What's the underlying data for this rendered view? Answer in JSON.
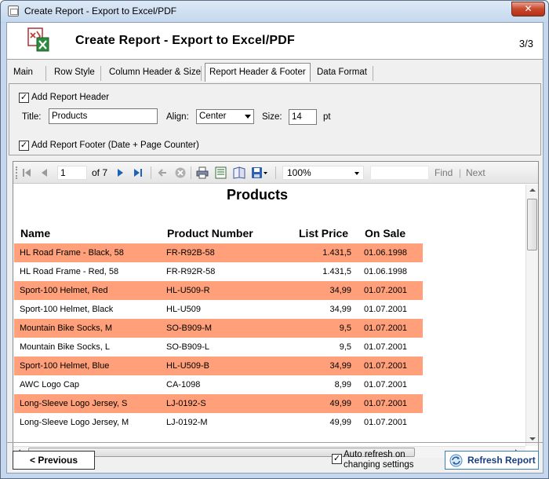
{
  "window": {
    "title": "Create Report - Export to Excel/PDF",
    "close_label": "✕"
  },
  "header": {
    "title": "Create Report - Export to Excel/PDF",
    "step": "3/3"
  },
  "tabs": [
    {
      "label": "Main",
      "active": false
    },
    {
      "label": "Row Style",
      "active": false
    },
    {
      "label": "Column Header & Size",
      "active": false
    },
    {
      "label": "Report Header & Footer",
      "active": true
    },
    {
      "label": "Data Format",
      "active": false
    }
  ],
  "settings": {
    "add_header_label": "Add Report Header",
    "add_header_checked": true,
    "title_label": "Title:",
    "title_value": "Products",
    "align_label": "Align:",
    "align_value": "Center",
    "size_label": "Size:",
    "size_value": "14",
    "size_unit": "pt",
    "add_footer_label": "Add Report Footer (Date + Page Counter)",
    "add_footer_checked": true
  },
  "viewer_toolbar": {
    "page": "1",
    "of_pages": "of 7",
    "zoom": "100%",
    "find": "Find",
    "sep": "|",
    "next": "Next"
  },
  "report": {
    "title": "Products",
    "columns": [
      "Name",
      "Product Number",
      "List Price",
      "On Sale"
    ],
    "row_color": "#ffa07a",
    "rows": [
      [
        "HL Road Frame - Black, 58",
        "FR-R92B-58",
        "1.431,5",
        "01.06.1998"
      ],
      [
        "HL Road Frame - Red, 58",
        "FR-R92R-58",
        "1.431,5",
        "01.06.1998"
      ],
      [
        "Sport-100 Helmet, Red",
        "HL-U509-R",
        "34,99",
        "01.07.2001"
      ],
      [
        "Sport-100 Helmet, Black",
        "HL-U509",
        "34,99",
        "01.07.2001"
      ],
      [
        "Mountain Bike Socks, M",
        "SO-B909-M",
        "9,5",
        "01.07.2001"
      ],
      [
        "Mountain Bike Socks, L",
        "SO-B909-L",
        "9,5",
        "01.07.2001"
      ],
      [
        "Sport-100 Helmet, Blue",
        "HL-U509-B",
        "34,99",
        "01.07.2001"
      ],
      [
        "AWC Logo Cap",
        "CA-1098",
        "8,99",
        "01.07.2001"
      ],
      [
        "Long-Sleeve Logo Jersey, S",
        "LJ-0192-S",
        "49,99",
        "01.07.2001"
      ],
      [
        "Long-Sleeve Logo Jersey, M",
        "LJ-0192-M",
        "49,99",
        "01.07.2001"
      ]
    ]
  },
  "footer": {
    "previous_label": "< Previous",
    "auto_refresh_label_1": "Auto refresh on",
    "auto_refresh_label_2": "changing settings",
    "auto_refresh_checked": true,
    "refresh_label": "Refresh Report"
  }
}
